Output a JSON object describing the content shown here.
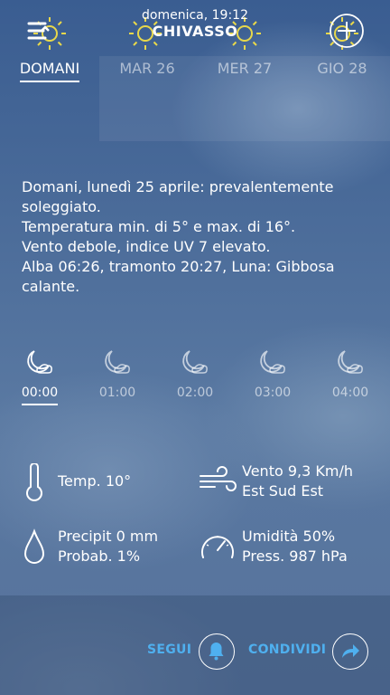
{
  "header": {
    "datetime": "domenica, 19:12",
    "city": "CHIVASSO",
    "menu_icon": "menu-icon",
    "add_icon": "add-location-icon"
  },
  "tabs": [
    {
      "label": "DOMANI",
      "active": true
    },
    {
      "label": "MAR 26",
      "active": false
    },
    {
      "label": "MER 27",
      "active": false
    },
    {
      "label": "GIO 28",
      "active": false
    }
  ],
  "description": {
    "line1": "Domani, lunedì 25 aprile: prevalentemente soleggiato.",
    "line2": "Temperatura min. di 5° e max. di 16°.",
    "line3": "Vento debole, indice UV 7 elevato.",
    "line4": "Alba 06:26, tramonto 20:27, Luna: Gibbosa calante."
  },
  "hours": [
    {
      "time": "00:00",
      "icon": "moon-clear-icon",
      "active": true
    },
    {
      "time": "01:00",
      "icon": "moon-clear-icon",
      "active": false
    },
    {
      "time": "02:00",
      "icon": "moon-clear-icon",
      "active": false
    },
    {
      "time": "03:00",
      "icon": "moon-clear-icon",
      "active": false
    },
    {
      "time": "04:00",
      "icon": "moon-clear-icon",
      "active": false
    }
  ],
  "details": {
    "temp": "Temp. 10°",
    "wind_speed": "Vento 9,3 Km/h",
    "wind_dir": "Est Sud Est",
    "precip": "Precipit 0 mm",
    "probab": "Probab. 1%",
    "humidity": "Umidità 50%",
    "pressure": "Press. 987 hPa"
  },
  "footer": {
    "follow_label": "SEGUI",
    "share_label": "CONDIVIDI"
  },
  "colors": {
    "accent": "#4fb0ef",
    "sun": "#e8d84a"
  }
}
